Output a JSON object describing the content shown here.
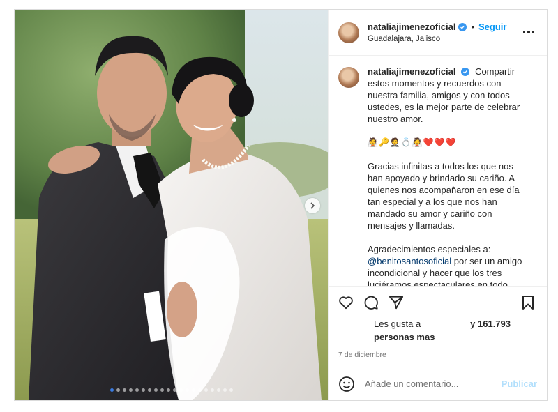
{
  "post": {
    "username": "nataliajimenezoficial",
    "follow_label": "Seguir",
    "separator": "•",
    "location": "Guadalajara, Jalisco",
    "media": {
      "slide_count": 20,
      "active_slide": 1
    }
  },
  "caption": {
    "username": "nataliajimenezoficial",
    "paragraph1": "Compartir estos momentos y recuerdos con nuestra familia, amigos y con todos ustedes, es la mejor parte de celebrar nuestro amor.",
    "emoji_line": "👰🔑🤵💍👰",
    "hearts": "❤️❤️❤️",
    "paragraph2": "Gracias infinitas a todos los que nos han apoyado y brindado su cariño. A quienes nos acompañaron en ese día tan especial y a los que nos han mandado su amor y cariño con mensajes y llamadas.",
    "paragraph3_intro": "Agradecimientos especiales a:",
    "mention": "@benitosantosoficial",
    "paragraph3_rest": "por ser un amigo incondicional y hacer que los tres luciéramos espectaculares en todo momento con sus hermoso"
  },
  "likes": {
    "prefix": "Les gusta a",
    "count_text": "y 161.793",
    "suffix": "personas mas"
  },
  "date": "7 de diciembre",
  "comment_input": {
    "placeholder": "Añade un comentario...",
    "value": ""
  },
  "publish_label": "Publicar",
  "colors": {
    "accent": "#0095f6",
    "verified": "#3897f0",
    "mention": "#00376b",
    "publish_disabled": "#b2dffc",
    "muted": "#737373"
  },
  "icons": {
    "like": "heart-icon",
    "comment": "comment-icon",
    "share": "paper-plane-icon",
    "save": "bookmark-icon",
    "more": "more-options-icon",
    "emoji": "smiley-icon",
    "next": "chevron-right-icon",
    "verified": "verified-badge-icon"
  }
}
